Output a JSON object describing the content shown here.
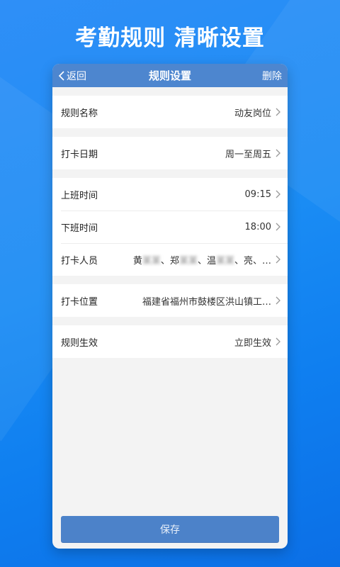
{
  "promo": {
    "headline": "考勤规则  清晰设置"
  },
  "navbar": {
    "back_label": "返回",
    "title": "规则设置",
    "delete_label": "删除"
  },
  "rules": {
    "name": {
      "label": "规则名称",
      "value": "动友岗位"
    },
    "date": {
      "label": "打卡日期",
      "value": "周一至周五"
    },
    "start": {
      "label": "上班时间",
      "value": "09:15"
    },
    "end": {
      "label": "下班时间",
      "value": "18:00"
    },
    "members": {
      "label": "打卡人员",
      "names": [
        "黄",
        "、郑",
        "、温",
        "、亮、…"
      ]
    },
    "location": {
      "label": "打卡位置",
      "value": "福建省福州市鼓楼区洪山镇工…"
    },
    "effective": {
      "label": "规则生效",
      "value": "立即生效"
    }
  },
  "footer": {
    "save_label": "保存"
  },
  "colors": {
    "navbar": "#4d86cf",
    "save_button": "#4c82c9",
    "background": "#1a8cf4"
  }
}
